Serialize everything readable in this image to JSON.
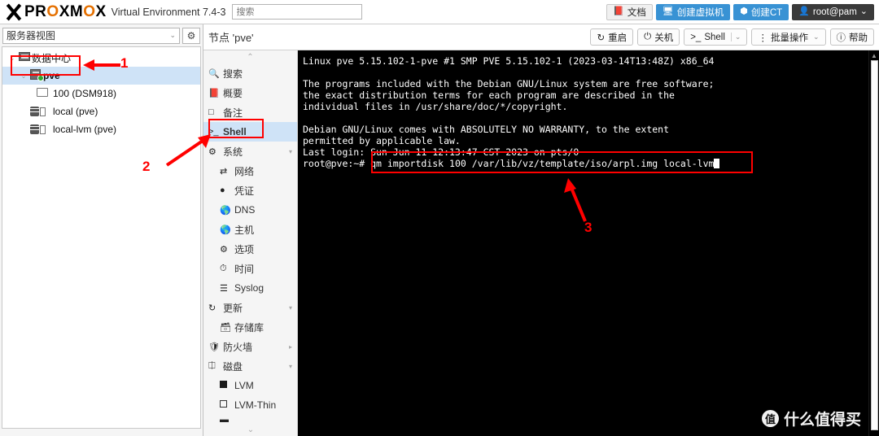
{
  "header": {
    "brand_pre": "PR",
    "brand_o1": "O",
    "brand_mid": "XM",
    "brand_o2": "O",
    "brand_post": "X",
    "product": "Virtual Environment 7.4-3",
    "search_placeholder": "搜索",
    "buttons": [
      {
        "label": "文档",
        "icon": "book-icon",
        "style": "light"
      },
      {
        "label": "创建虚拟机",
        "icon": "monitor-icon",
        "style": "blue"
      },
      {
        "label": "创建CT",
        "icon": "cube-icon",
        "style": "blue"
      },
      {
        "label": "root@pam",
        "icon": "user-icon",
        "style": "dark",
        "chevron": "⌄"
      }
    ]
  },
  "tree": {
    "view_label": "服务器视图",
    "view_chevron": "⌄",
    "gear_icon": "gear-icon",
    "nodes": [
      {
        "label": "数据中心",
        "icon": "datacenter-icon",
        "twisty": "⌄",
        "indent": 0,
        "selected": false
      },
      {
        "label": "pve",
        "icon": "server-online-icon",
        "twisty": "⌄",
        "indent": 1,
        "selected": true
      },
      {
        "label": "100 (DSM918)",
        "icon": "qemu-vm-icon",
        "twisty": "",
        "indent": 2,
        "selected": false
      },
      {
        "label": "local (pve)",
        "icon": "storage-icon",
        "twisty": "",
        "indent": 2,
        "selected": false
      },
      {
        "label": "local-lvm (pve)",
        "icon": "storage-icon",
        "twisty": "",
        "indent": 2,
        "selected": false
      }
    ]
  },
  "content": {
    "title": "节点 'pve'",
    "toolbar": [
      {
        "label": "重启",
        "icon": "restart-icon"
      },
      {
        "label": "关机",
        "icon": "power-icon"
      },
      {
        "label": "Shell",
        "icon": "shell-icon",
        "chevron": "⌄"
      },
      {
        "label": "批量操作",
        "icon": "kebab-icon",
        "chevron": "⌄"
      },
      {
        "label": "帮助",
        "icon": "help-icon"
      }
    ]
  },
  "nav": {
    "scroll_up": "⌃",
    "scroll_down": "⌄",
    "items": [
      {
        "label": "搜索",
        "icon": "search-icon",
        "sub": false,
        "selected": false,
        "chevron": ""
      },
      {
        "label": "概要",
        "icon": "summary-icon",
        "sub": false,
        "selected": false,
        "chevron": ""
      },
      {
        "label": "备注",
        "icon": "notes-icon",
        "sub": false,
        "selected": false,
        "chevron": ""
      },
      {
        "label": "Shell",
        "icon": "shell-icon",
        "sub": false,
        "selected": true,
        "chevron": ""
      },
      {
        "label": "系统",
        "icon": "system-icon",
        "sub": false,
        "selected": false,
        "chevron": "▾"
      },
      {
        "label": "网络",
        "icon": "network-icon",
        "sub": true,
        "selected": false,
        "chevron": ""
      },
      {
        "label": "凭证",
        "icon": "certificate-icon",
        "sub": true,
        "selected": false,
        "chevron": ""
      },
      {
        "label": "DNS",
        "icon": "dns-globe-icon",
        "sub": true,
        "selected": false,
        "chevron": ""
      },
      {
        "label": "主机",
        "icon": "hosts-globe-icon",
        "sub": true,
        "selected": false,
        "chevron": ""
      },
      {
        "label": "选项",
        "icon": "options-gear-icon",
        "sub": true,
        "selected": false,
        "chevron": ""
      },
      {
        "label": "时间",
        "icon": "clock-icon",
        "sub": true,
        "selected": false,
        "chevron": ""
      },
      {
        "label": "Syslog",
        "icon": "syslog-icon",
        "sub": true,
        "selected": false,
        "chevron": ""
      },
      {
        "label": "更新",
        "icon": "updates-icon",
        "sub": false,
        "selected": false,
        "chevron": "▾"
      },
      {
        "label": "存储库",
        "icon": "repository-icon",
        "sub": true,
        "selected": false,
        "chevron": ""
      },
      {
        "label": "防火墙",
        "icon": "firewall-shield-icon",
        "sub": false,
        "selected": false,
        "chevron": "▸"
      },
      {
        "label": "磁盘",
        "icon": "disk-icon",
        "sub": false,
        "selected": false,
        "chevron": "▾"
      },
      {
        "label": "LVM",
        "icon": "lvm-filled-icon",
        "sub": true,
        "selected": false,
        "chevron": ""
      },
      {
        "label": "LVM-Thin",
        "icon": "lvm-thin-icon",
        "sub": true,
        "selected": false,
        "chevron": ""
      },
      {
        "label": "",
        "icon": "directory-icon",
        "sub": true,
        "selected": false,
        "chevron": ""
      }
    ]
  },
  "terminal": {
    "line_kernel": "Linux pve 5.15.102-1-pve #1 SMP PVE 5.15.102-1 (2023-03-14T13:48Z) x86_64",
    "line_blank1": "",
    "line_prog1": "The programs included with the Debian GNU/Linux system are free software;",
    "line_prog2": "the exact distribution terms for each program are described in the",
    "line_prog3": "individual files in /usr/share/doc/*/copyright.",
    "line_blank2": "",
    "line_warranty1": "Debian GNU/Linux comes with ABSOLUTELY NO WARRANTY, to the extent",
    "line_warranty2": "permitted by applicable law.",
    "line_lastlogin": "Last login: Sun Jun 11 12:13:47 CST 2023 on pts/0",
    "prompt": "root@pve:~# ",
    "command": "qm importdisk 100 /var/lib/vz/template/iso/arpl.img local-lvm",
    "scroll_up": "▲",
    "watermark_mark": "值",
    "watermark_text": "什么值得买"
  },
  "annotations": {
    "accent_color": "#ff0000",
    "marks": [
      {
        "number": "1",
        "target": "tree-node-pve"
      },
      {
        "number": "2",
        "target": "nav-item-shell"
      },
      {
        "number": "3",
        "target": "terminal-command"
      }
    ]
  }
}
